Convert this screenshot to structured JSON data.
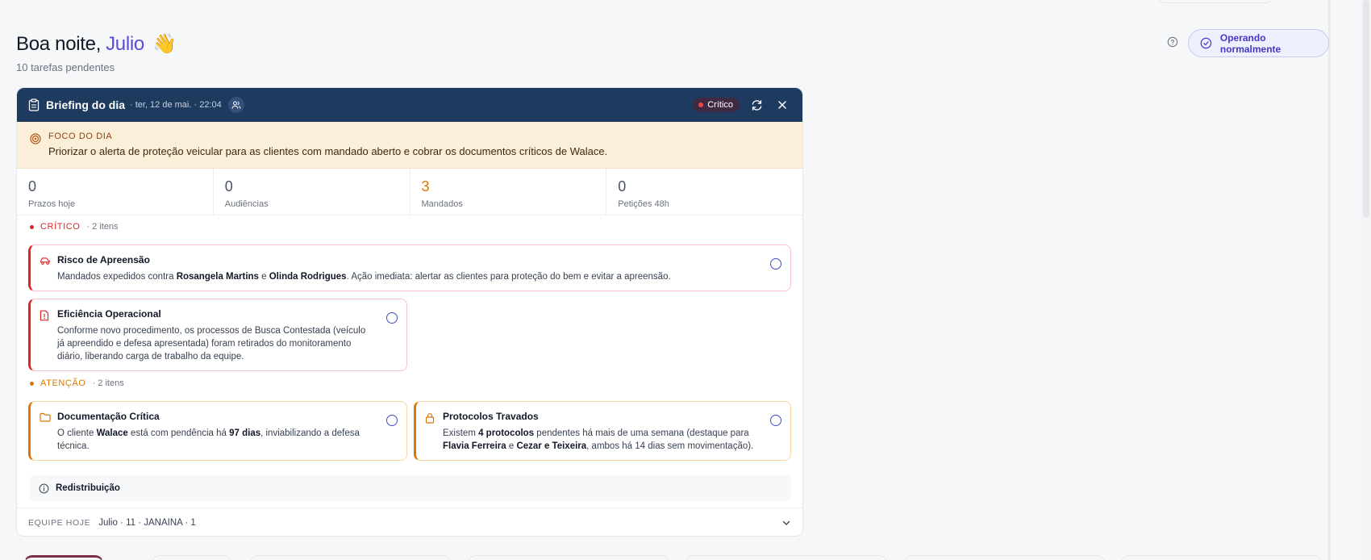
{
  "greeting": {
    "prefix": "Boa noite,",
    "name": "Julio",
    "emoji": "👋"
  },
  "subtitle": "10 tarefas pendentes",
  "status": {
    "label": "Operando normalmente"
  },
  "briefing": {
    "title": "Briefing do dia",
    "meta": "· ter, 12 de mai. · 22:04",
    "badge": "Crítico",
    "focus": {
      "label": "FOCO DO DIA",
      "text": "Priorizar o alerta de proteção veicular para as clientes com mandado aberto e cobrar os documentos críticos de Walace."
    },
    "stats": [
      {
        "value": "0",
        "label": "Prazos hoje"
      },
      {
        "value": "0",
        "label": "Audiências"
      },
      {
        "value": "3",
        "label": "Mandados"
      },
      {
        "value": "0",
        "label": "Petições 48h"
      }
    ],
    "critical": {
      "label": "CRÍTICO",
      "count": "· 2 itens",
      "cards": [
        {
          "title": "Risco de Apreensão",
          "body": [
            {
              "t": "Mandados expedidos contra "
            },
            {
              "t": "Rosangela Martins",
              "b": true
            },
            {
              "t": " e "
            },
            {
              "t": "Olinda Rodrigues",
              "b": true
            },
            {
              "t": ". Ação imediata: alertar as clientes para proteção do bem e evitar a apreensão."
            }
          ]
        },
        {
          "title": "Eficiência Operacional",
          "body": [
            {
              "t": "Conforme novo procedimento, os processos de Busca Contestada (veículo já apreendido e defesa apresentada) foram retirados do monitoramento diário, liberando carga de trabalho da equipe."
            }
          ]
        }
      ]
    },
    "attention": {
      "label": "ATENÇÃO",
      "count": "· 2 itens",
      "cards": [
        {
          "title": "Documentação Crítica",
          "body": [
            {
              "t": "O cliente "
            },
            {
              "t": "Walace",
              "b": true
            },
            {
              "t": " está com pendência há "
            },
            {
              "t": "97 dias",
              "b": true
            },
            {
              "t": ", inviabilizando a defesa técnica."
            }
          ]
        },
        {
          "title": "Protocolos Travados",
          "body": [
            {
              "t": "Existem "
            },
            {
              "t": "4 protocolos",
              "b": true
            },
            {
              "t": " pendentes há mais de uma semana (destaque para "
            },
            {
              "t": "Flavia Ferreira",
              "b": true
            },
            {
              "t": " e "
            },
            {
              "t": "Cezar e Teixeira",
              "b": true
            },
            {
              "t": ", ambos há 14 dias sem movimentação)."
            }
          ]
        }
      ]
    },
    "redistribution": {
      "label": "Redistribuição"
    },
    "team": {
      "label": "EQUIPE HOJE",
      "value": "Julio · 11 · JANAINA · 1"
    }
  },
  "colors": {
    "header": "#1e3a5f",
    "accent": "#5b4bd6",
    "critical": "#dc2626",
    "attention": "#d97706",
    "focus_bg": "#fcefd9"
  },
  "icons": {
    "help": "help-circle-icon",
    "status": "check-circle-icon",
    "briefing": "clipboard-icon",
    "team": "users-icon",
    "refresh": "refresh-icon",
    "close": "close-icon",
    "focus": "target-icon",
    "card_0": "car-icon",
    "card_1": "file-alert-icon",
    "card_2": "folder-icon",
    "card_3": "lock-icon",
    "redistribution": "info-icon",
    "team_toggle": "chevron-down-icon"
  }
}
